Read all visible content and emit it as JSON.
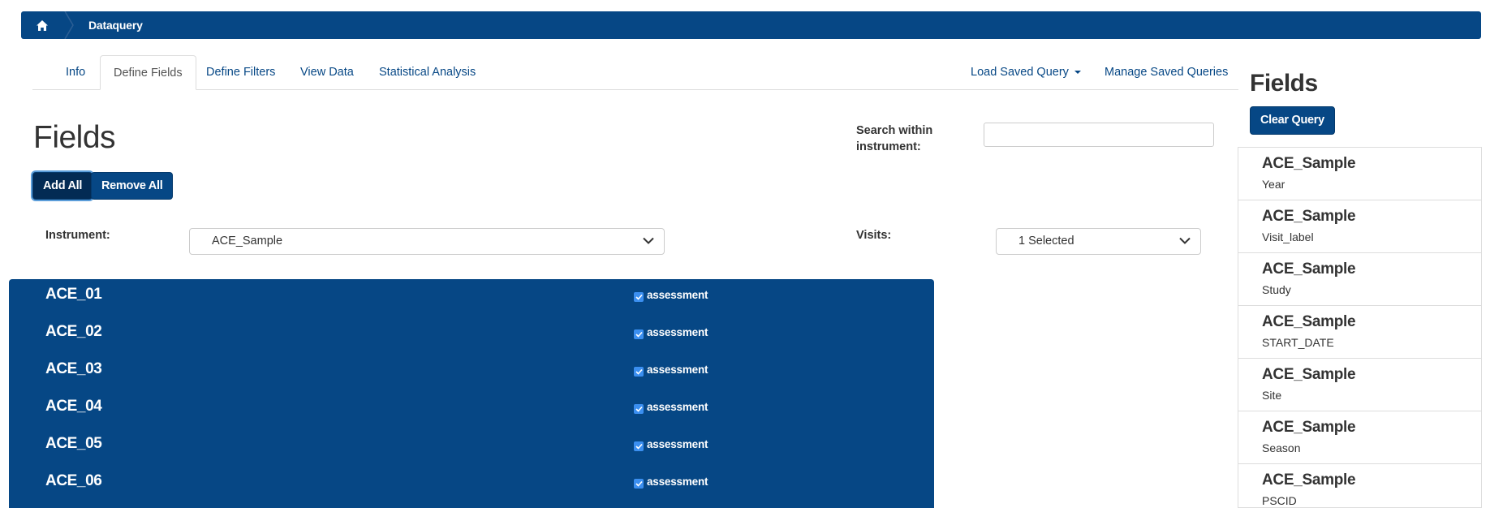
{
  "breadcrumb": {
    "home_icon": "home-icon",
    "current": "Dataquery"
  },
  "colors": {
    "brand": "#064785",
    "page_bg": "#ffffff",
    "border": "#dddddd"
  },
  "tabs": [
    {
      "label": "Info",
      "active": false
    },
    {
      "label": "Define Fields",
      "active": true
    },
    {
      "label": "Define Filters",
      "active": false
    },
    {
      "label": "View Data",
      "active": false
    },
    {
      "label": "Statistical Analysis",
      "active": false
    }
  ],
  "right_tabs": {
    "load_saved": "Load Saved Query",
    "manage_saved": "Manage Saved Queries"
  },
  "main": {
    "title": "Fields",
    "add_all": "Add All",
    "remove_all": "Remove All",
    "search_label": "Search within instrument:",
    "search_value": "",
    "instrument_label": "Instrument:",
    "instrument_value": "ACE_Sample",
    "visits_label": "Visits:",
    "visits_value": "1 Selected"
  },
  "field_rows": [
    {
      "name": "ACE_01",
      "tag": "assessment",
      "checked": true
    },
    {
      "name": "ACE_02",
      "tag": "assessment",
      "checked": true
    },
    {
      "name": "ACE_03",
      "tag": "assessment",
      "checked": true
    },
    {
      "name": "ACE_04",
      "tag": "assessment",
      "checked": true
    },
    {
      "name": "ACE_05",
      "tag": "assessment",
      "checked": true
    },
    {
      "name": "ACE_06",
      "tag": "assessment",
      "checked": true
    }
  ],
  "sidebar": {
    "title": "Fields",
    "clear_button": "Clear Query",
    "items": [
      {
        "instrument": "ACE_Sample",
        "field": "Year"
      },
      {
        "instrument": "ACE_Sample",
        "field": "Visit_label"
      },
      {
        "instrument": "ACE_Sample",
        "field": "Study"
      },
      {
        "instrument": "ACE_Sample",
        "field": "START_DATE"
      },
      {
        "instrument": "ACE_Sample",
        "field": "Site"
      },
      {
        "instrument": "ACE_Sample",
        "field": "Season"
      },
      {
        "instrument": "ACE_Sample",
        "field": "PSCID"
      }
    ]
  }
}
